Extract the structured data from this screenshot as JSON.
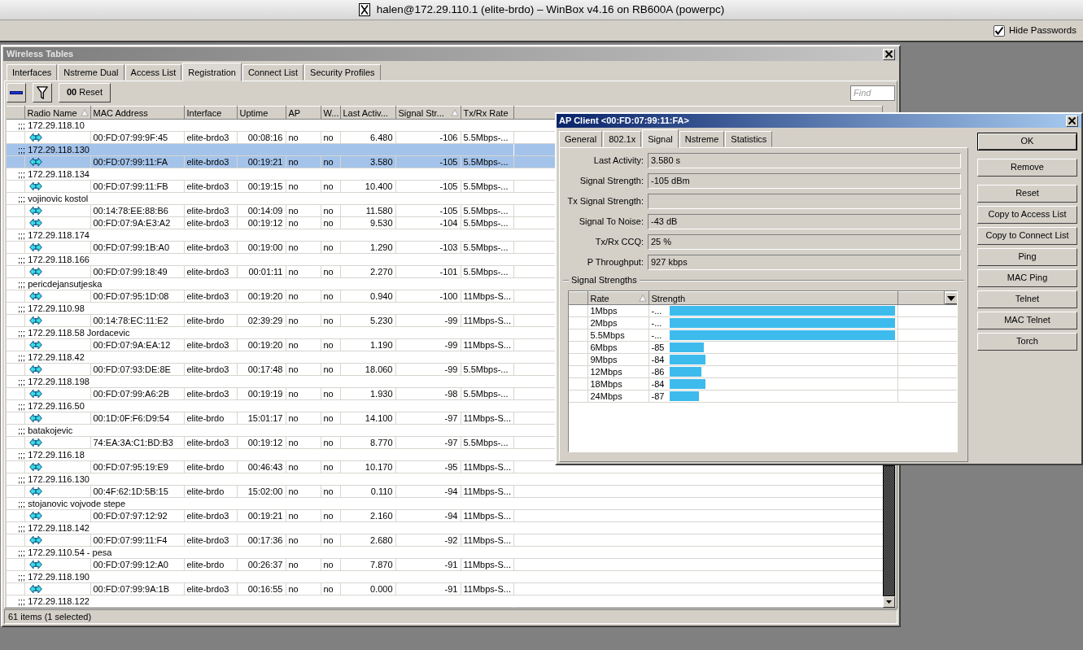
{
  "window": {
    "title": "halen@172.29.110.1 (elite-brdo) – WinBox v4.16 on RB600A (powerpc)"
  },
  "toolbar": {
    "hide_passwords": {
      "label": "Hide Passwords",
      "checked": true
    }
  },
  "wireless_tables": {
    "title": "Wireless Tables",
    "tabs": [
      {
        "label": "Interfaces",
        "selected": false
      },
      {
        "label": "Nstreme Dual",
        "selected": false
      },
      {
        "label": "Access List",
        "selected": false
      },
      {
        "label": "Registration",
        "selected": true
      },
      {
        "label": "Connect List",
        "selected": false
      },
      {
        "label": "Security Profiles",
        "selected": false
      }
    ],
    "actions": [
      {
        "kind": "remove"
      },
      {
        "kind": "filter"
      },
      {
        "kind": "reset",
        "label": "**00** Reset"
      }
    ],
    "search": {
      "placeholder": "Find"
    },
    "table": {
      "columns": [
        {
          "label": "Radio Name",
          "sorted": true
        },
        {
          "label": "MAC Address",
          "sorted": false
        },
        {
          "label": "Interface",
          "sorted": false
        },
        {
          "label": "Uptime",
          "sorted": false
        },
        {
          "label": "AP",
          "sorted": false
        },
        {
          "label": "W...",
          "sorted": false
        },
        {
          "label": "Last Activ...",
          "sorted": false
        },
        {
          "label": "Signal Str...",
          "sorted": true
        },
        {
          "label": "Tx/Rx Rate",
          "sorted": false
        }
      ],
      "rows": [
        {
          "kind": "comment",
          "text": ";;; 172.29.118.10",
          "selected": false
        },
        {
          "kind": "entry",
          "selected": false,
          "mac_address": "00:FD:07:99:9F:45",
          "interface": "elite-brdo3",
          "uptime": "00:08:16",
          "ap": "no",
          "column_w": "no",
          "last_activity": "6.480",
          "signal_strength": "-106",
          "tx_rx_rate": "5.5Mbps-..."
        },
        {
          "kind": "comment",
          "text": ";;; 172.29.118.130",
          "selected": true
        },
        {
          "kind": "entry",
          "selected": true,
          "mac_address": "00:FD:07:99:11:FA",
          "interface": "elite-brdo3",
          "uptime": "00:19:21",
          "ap": "no",
          "column_w": "no",
          "last_activity": "3.580",
          "signal_strength": "-105",
          "tx_rx_rate": "5.5Mbps-..."
        },
        {
          "kind": "comment",
          "text": ";;; 172.29.118.134",
          "selected": false
        },
        {
          "kind": "entry",
          "selected": false,
          "mac_address": "00:FD:07:99:11:FB",
          "interface": "elite-brdo3",
          "uptime": "00:19:15",
          "ap": "no",
          "column_w": "no",
          "last_activity": "10.400",
          "signal_strength": "-105",
          "tx_rx_rate": "5.5Mbps-..."
        },
        {
          "kind": "comment",
          "text": ";;; vojinovic kostol",
          "selected": false
        },
        {
          "kind": "entry",
          "selected": false,
          "mac_address": "00:14:78:EE:88:B6",
          "interface": "elite-brdo3",
          "uptime": "00:14:09",
          "ap": "no",
          "column_w": "no",
          "last_activity": "11.580",
          "signal_strength": "-105",
          "tx_rx_rate": "5.5Mbps-..."
        },
        {
          "kind": "entry",
          "selected": false,
          "mac_address": "00:FD:07:9A:E3:A2",
          "interface": "elite-brdo3",
          "uptime": "00:19:12",
          "ap": "no",
          "column_w": "no",
          "last_activity": "9.530",
          "signal_strength": "-104",
          "tx_rx_rate": "5.5Mbps-..."
        },
        {
          "kind": "comment",
          "text": ";;; 172.29.118.174",
          "selected": false
        },
        {
          "kind": "entry",
          "selected": false,
          "mac_address": "00:FD:07:99:1B:A0",
          "interface": "elite-brdo3",
          "uptime": "00:19:00",
          "ap": "no",
          "column_w": "no",
          "last_activity": "1.290",
          "signal_strength": "-103",
          "tx_rx_rate": "5.5Mbps-..."
        },
        {
          "kind": "comment",
          "text": ";;; 172.29.118.166",
          "selected": false
        },
        {
          "kind": "entry",
          "selected": false,
          "mac_address": "00:FD:07:99:18:49",
          "interface": "elite-brdo3",
          "uptime": "00:01:11",
          "ap": "no",
          "column_w": "no",
          "last_activity": "2.270",
          "signal_strength": "-101",
          "tx_rx_rate": "5.5Mbps-..."
        },
        {
          "kind": "comment",
          "text": ";;; pericdejansutjeska",
          "selected": false
        },
        {
          "kind": "entry",
          "selected": false,
          "mac_address": "00:FD:07:95:1D:08",
          "interface": "elite-brdo3",
          "uptime": "00:19:20",
          "ap": "no",
          "column_w": "no",
          "last_activity": "0.940",
          "signal_strength": "-100",
          "tx_rx_rate": "11Mbps-S..."
        },
        {
          "kind": "comment",
          "text": ";;; 172.29.110.98",
          "selected": false
        },
        {
          "kind": "entry",
          "selected": false,
          "mac_address": "00:14:78:EC:11:E2",
          "interface": "elite-brdo",
          "uptime": "02:39:29",
          "ap": "no",
          "column_w": "no",
          "last_activity": "5.230",
          "signal_strength": "-99",
          "tx_rx_rate": "11Mbps-S..."
        },
        {
          "kind": "comment",
          "text": ";;; 172.29.118.58 Jordacevic",
          "selected": false
        },
        {
          "kind": "entry",
          "selected": false,
          "mac_address": "00:FD:07:9A:EA:12",
          "interface": "elite-brdo3",
          "uptime": "00:19:20",
          "ap": "no",
          "column_w": "no",
          "last_activity": "1.190",
          "signal_strength": "-99",
          "tx_rx_rate": "11Mbps-S..."
        },
        {
          "kind": "comment",
          "text": ";;; 172.29.118.42",
          "selected": false
        },
        {
          "kind": "entry",
          "selected": false,
          "mac_address": "00:FD:07:93:DE:8E",
          "interface": "elite-brdo3",
          "uptime": "00:17:48",
          "ap": "no",
          "column_w": "no",
          "last_activity": "18.060",
          "signal_strength": "-99",
          "tx_rx_rate": "5.5Mbps-..."
        },
        {
          "kind": "comment",
          "text": ";;; 172.29.118.198",
          "selected": false
        },
        {
          "kind": "entry",
          "selected": false,
          "mac_address": "00:FD:07:99:A6:2B",
          "interface": "elite-brdo3",
          "uptime": "00:19:19",
          "ap": "no",
          "column_w": "no",
          "last_activity": "1.930",
          "signal_strength": "-98",
          "tx_rx_rate": "5.5Mbps-..."
        },
        {
          "kind": "comment",
          "text": ";;; 172.29.116.50",
          "selected": false
        },
        {
          "kind": "entry",
          "selected": false,
          "mac_address": "00:1D:0F:F6:D9:54",
          "interface": "elite-brdo",
          "uptime": "15:01:17",
          "ap": "no",
          "column_w": "no",
          "last_activity": "14.100",
          "signal_strength": "-97",
          "tx_rx_rate": "11Mbps-S..."
        },
        {
          "kind": "comment",
          "text": ";;; batakojevic",
          "selected": false
        },
        {
          "kind": "entry",
          "selected": false,
          "mac_address": "74:EA:3A:C1:BD:B3",
          "interface": "elite-brdo3",
          "uptime": "00:19:12",
          "ap": "no",
          "column_w": "no",
          "last_activity": "8.770",
          "signal_strength": "-97",
          "tx_rx_rate": "5.5Mbps-..."
        },
        {
          "kind": "comment",
          "text": ";;; 172.29.116.18",
          "selected": false
        },
        {
          "kind": "entry",
          "selected": false,
          "mac_address": "00:FD:07:95:19:E9",
          "interface": "elite-brdo",
          "uptime": "00:46:43",
          "ap": "no",
          "column_w": "no",
          "last_activity": "10.170",
          "signal_strength": "-95",
          "tx_rx_rate": "11Mbps-S..."
        },
        {
          "kind": "comment",
          "text": ";;; 172.29.116.130",
          "selected": false
        },
        {
          "kind": "entry",
          "selected": false,
          "mac_address": "00:4F:62:1D:5B:15",
          "interface": "elite-brdo",
          "uptime": "15:02:00",
          "ap": "no",
          "column_w": "no",
          "last_activity": "0.110",
          "signal_strength": "-94",
          "tx_rx_rate": "11Mbps-S..."
        },
        {
          "kind": "comment",
          "text": ";;; stojanovic vojvode stepe",
          "selected": false
        },
        {
          "kind": "entry",
          "selected": false,
          "mac_address": "00:FD:07:97:12:92",
          "interface": "elite-brdo3",
          "uptime": "00:19:21",
          "ap": "no",
          "column_w": "no",
          "last_activity": "2.160",
          "signal_strength": "-94",
          "tx_rx_rate": "11Mbps-S..."
        },
        {
          "kind": "comment",
          "text": ";;; 172.29.118.142",
          "selected": false
        },
        {
          "kind": "entry",
          "selected": false,
          "mac_address": "00:FD:07:99:11:F4",
          "interface": "elite-brdo3",
          "uptime": "00:17:36",
          "ap": "no",
          "column_w": "no",
          "last_activity": "2.680",
          "signal_strength": "-92",
          "tx_rx_rate": "11Mbps-S..."
        },
        {
          "kind": "comment",
          "text": ";;; 172.29.110.54 - pesa",
          "selected": false
        },
        {
          "kind": "entry",
          "selected": false,
          "mac_address": "00:FD:07:99:12:A0",
          "interface": "elite-brdo",
          "uptime": "00:26:37",
          "ap": "no",
          "column_w": "no",
          "last_activity": "7.870",
          "signal_strength": "-91",
          "tx_rx_rate": "11Mbps-S..."
        },
        {
          "kind": "comment",
          "text": ";;; 172.29.118.190",
          "selected": false
        },
        {
          "kind": "entry",
          "selected": false,
          "mac_address": "00:FD:07:99:9A:1B",
          "interface": "elite-brdo3",
          "uptime": "00:16:55",
          "ap": "no",
          "column_w": "no",
          "last_activity": "0.000",
          "signal_strength": "-91",
          "tx_rx_rate": "11Mbps-S..."
        },
        {
          "kind": "comment",
          "text": ";;; 172.29.118.122",
          "selected": false
        }
      ]
    },
    "status_bar": "61 items (1 selected)"
  },
  "ap_client": {
    "title": "AP Client <00:FD:07:99:11:FA>",
    "tabs": [
      {
        "label": "General",
        "selected": false
      },
      {
        "label": "802.1x",
        "selected": false
      },
      {
        "label": "Signal",
        "selected": true
      },
      {
        "label": "Nstreme",
        "selected": false
      },
      {
        "label": "Statistics",
        "selected": false
      }
    ],
    "fields": [
      {
        "label": "Last Activity:",
        "value": "3.580 s"
      },
      {
        "label": "Signal Strength:",
        "value": "-105 dBm"
      },
      {
        "label": "Tx Signal Strength:"
      },
      {
        "label": "Signal To Noise:",
        "value": "-43 dB"
      },
      {
        "label": "Tx/Rx CCQ:",
        "value": "25 %"
      },
      {
        "label": "P Throughput:",
        "value": "927 kbps"
      }
    ],
    "signal_strengths": {
      "title": "Signal Strengths",
      "columns": [
        {
          "label": "Rate",
          "sorted": true
        },
        {
          "label": "Strength",
          "sorted": false
        }
      ],
      "rows": [
        {
          "rate": "1Mbps",
          "strength": "-...",
          "level": 1
        },
        {
          "rate": "2Mbps",
          "strength": "-...",
          "level": 1
        },
        {
          "rate": "5.5Mbps",
          "strength": "-...",
          "level": 1
        },
        {
          "rate": "6Mbps",
          "strength": "-85",
          "level": 0.15
        },
        {
          "rate": "9Mbps",
          "strength": "-84",
          "level": 0.16
        },
        {
          "rate": "12Mbps",
          "strength": "-86",
          "level": 0.14
        },
        {
          "rate": "18Mbps",
          "strength": "-84",
          "level": 0.16
        },
        {
          "rate": "24Mbps",
          "strength": "-87",
          "level": 0.13
        }
      ]
    },
    "buttons": [
      {
        "label": "OK",
        "default": true
      },
      {
        "label": "Remove",
        "default": false
      },
      {
        "label": "Reset",
        "default": false
      },
      {
        "label": "Copy to Access List",
        "default": false
      },
      {
        "label": "Copy to Connect List",
        "default": false
      },
      {
        "label": "Ping",
        "default": false
      },
      {
        "label": "MAC Ping",
        "default": false
      },
      {
        "label": "Telnet",
        "default": false
      },
      {
        "label": "MAC Telnet",
        "default": false
      },
      {
        "label": "Torch",
        "default": false
      }
    ]
  }
}
